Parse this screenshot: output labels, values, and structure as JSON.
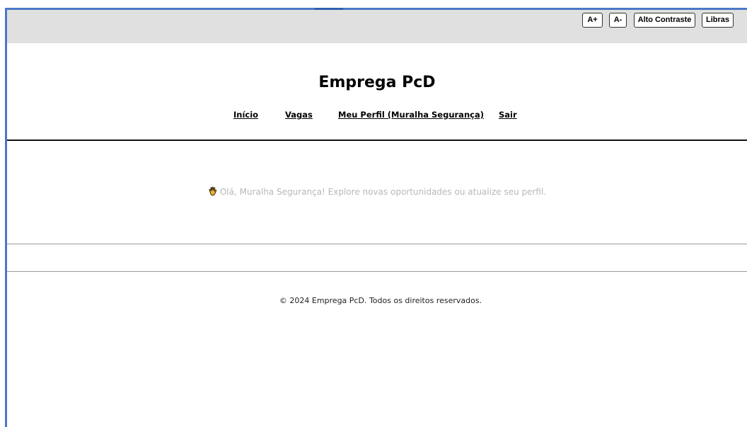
{
  "accessibility_bar": {
    "font_increase_label": "A+",
    "font_decrease_label": "A-",
    "high_contrast_label": "Alto Contraste",
    "libras_label": "Libras"
  },
  "header": {
    "site_title": "Emprega PcD",
    "nav": {
      "inicio": "Início",
      "vagas": "Vagas",
      "meu_perfil": "Meu Perfil (Muralha Segurança)",
      "sair": "Sair"
    }
  },
  "main": {
    "welcome_icon": "waving-hand-icon",
    "welcome_message": "Olá, Muralha Segurança! Explore novas oportunidades ou atualize seu perfil."
  },
  "footer": {
    "copyright": "© 2024 Emprega PcD. Todos os direitos reservados."
  },
  "colors": {
    "window_accent": "#4a78c8",
    "toolbar_background": "#e0e0e0",
    "welcome_text": "#b8b8b8"
  }
}
